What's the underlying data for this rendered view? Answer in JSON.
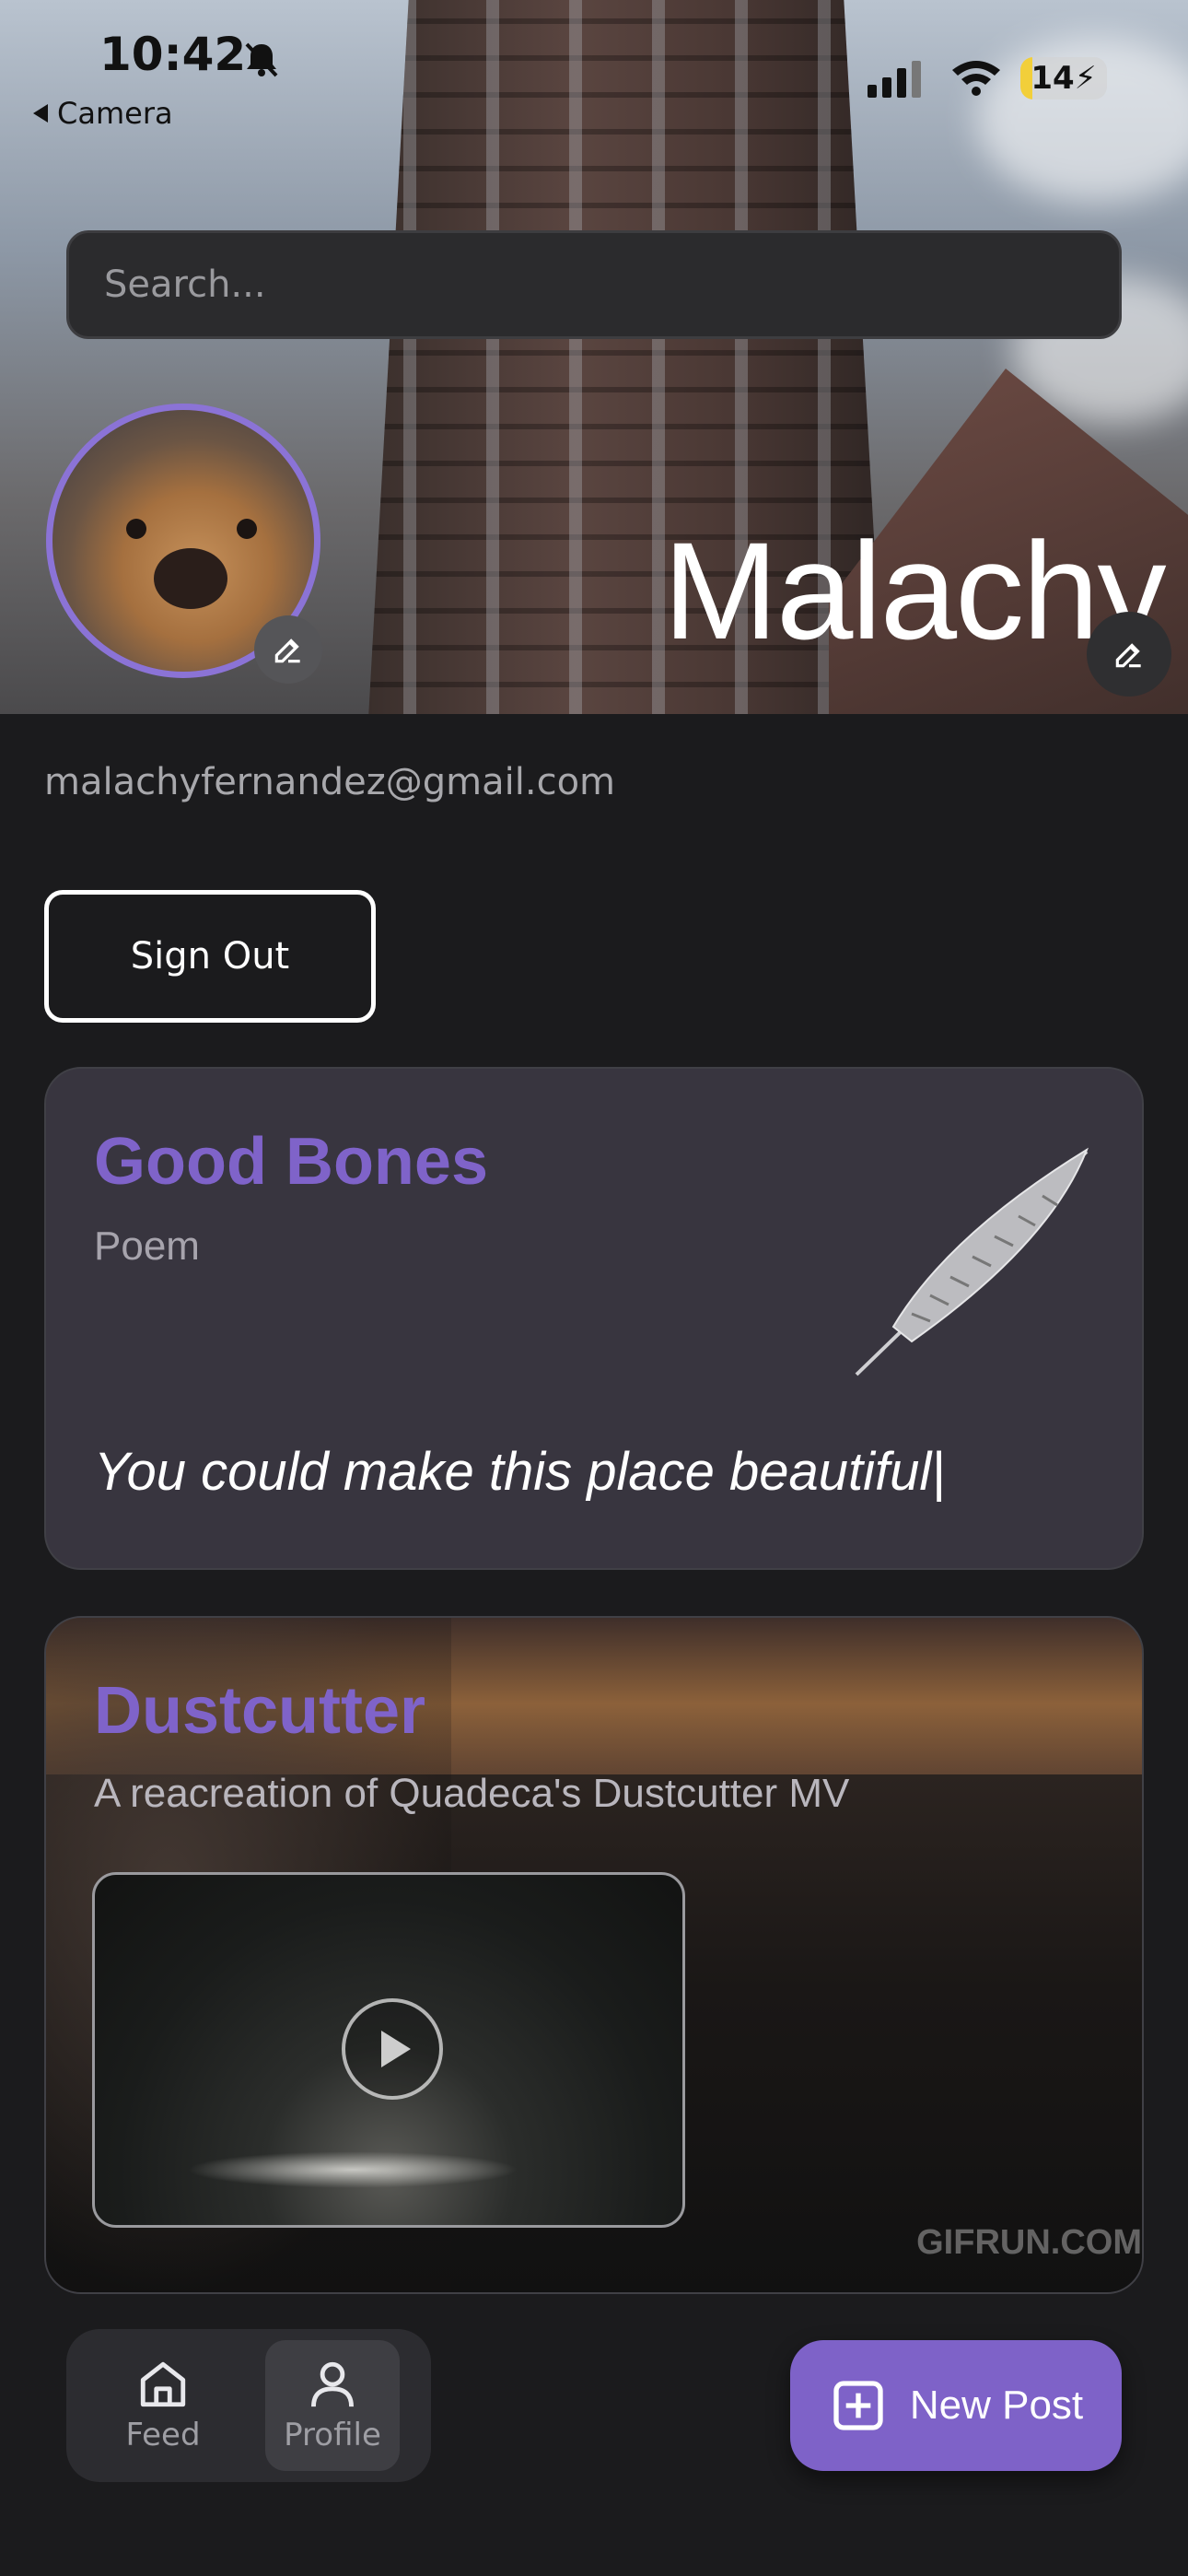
{
  "status_bar": {
    "time": "10:42",
    "back_app": "Camera",
    "battery": "14",
    "battery_level_pct": 14
  },
  "search": {
    "placeholder": "Search..."
  },
  "profile": {
    "name": "Malachy",
    "email": "malachyfernandez@gmail.com",
    "sign_out_label": "Sign Out"
  },
  "posts": [
    {
      "title": "Good Bones",
      "subtitle": "Poem",
      "excerpt": "You could make this place beautiful|",
      "icon": "quill-icon"
    },
    {
      "title": "Dustcutter",
      "subtitle": "A reacreation of Quadeca's Dustcutter MV",
      "watermark": "GIFRUN.COM",
      "icon": "play-icon"
    }
  ],
  "nav": {
    "feed_label": "Feed",
    "profile_label": "Profile",
    "active": "Profile"
  },
  "new_post_label": "New Post",
  "colors": {
    "accent": "#7e62c8",
    "title_accent": "#7f63c9",
    "background": "#1b1b1d",
    "card": "#38353f"
  }
}
